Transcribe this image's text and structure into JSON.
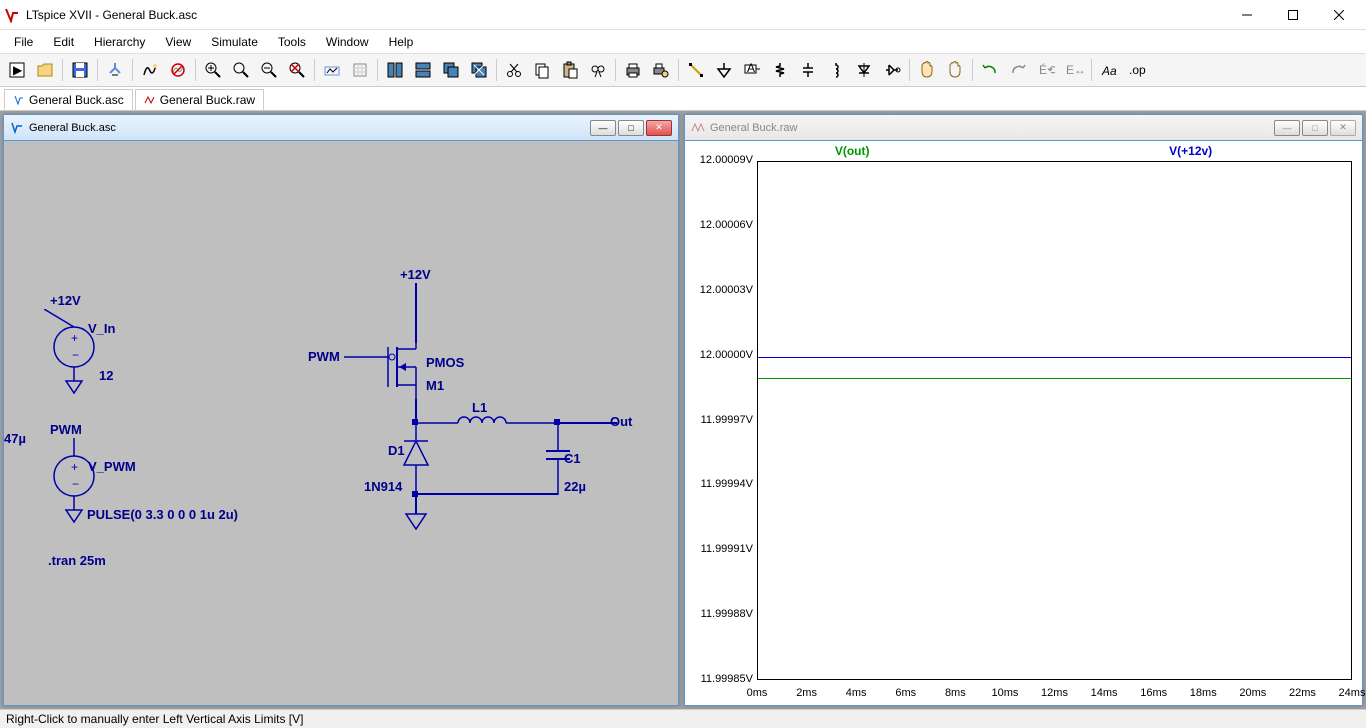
{
  "app": {
    "title": "LTspice XVII - General Buck.asc"
  },
  "menu": {
    "file": "File",
    "edit": "Edit",
    "hierarchy": "Hierarchy",
    "view": "View",
    "simulate": "Simulate",
    "tools": "Tools",
    "window": "Window",
    "help": "Help"
  },
  "tabs": {
    "schematic": "General Buck.asc",
    "raw": "General Buck.raw"
  },
  "subwin": {
    "schematic_title": "General Buck.asc",
    "plot_title": "General Buck.raw"
  },
  "schematic": {
    "net_12v": "+12V",
    "v_in": "V_In",
    "v_in_val": "12",
    "net_pwm": "PWM",
    "v_pwm": "V_PWM",
    "v_pwm_val": "PULSE(0 3.3 0 0 0 1u 2u)",
    "tran": ".tran 25m",
    "net_12v_2": "+12V",
    "pwm_label": "PWM",
    "pmos": "PMOS",
    "m1": "M1",
    "l1": "L1",
    "l1_val": "47µ",
    "d1": "D1",
    "d1_val": "1N914",
    "c1": "C1",
    "c1_val": "22µ",
    "out": "Out"
  },
  "plot": {
    "legend_vout": "V(out)",
    "legend_v12": "V(+12v)"
  },
  "chart_data": {
    "type": "line",
    "title": "",
    "xlabel": "",
    "ylabel": "",
    "x_unit": "ms",
    "y_unit": "V",
    "xlim": [
      0,
      24
    ],
    "ylim": [
      11.99985,
      12.00009
    ],
    "xticks": [
      0,
      2,
      4,
      6,
      8,
      10,
      12,
      14,
      16,
      18,
      20,
      22,
      24
    ],
    "xtick_labels": [
      "0ms",
      "2ms",
      "4ms",
      "6ms",
      "8ms",
      "10ms",
      "12ms",
      "14ms",
      "16ms",
      "18ms",
      "20ms",
      "22ms",
      "24ms"
    ],
    "yticks": [
      11.99985,
      11.99988,
      11.99991,
      11.99994,
      11.99997,
      12.0,
      12.00003,
      12.00006,
      12.00009
    ],
    "ytick_labels": [
      "11.99985V",
      "11.99988V",
      "11.99991V",
      "11.99994V",
      "11.99997V",
      "12.00000V",
      "12.00003V",
      "12.00006V",
      "12.00009V"
    ],
    "series": [
      {
        "name": "V(out)",
        "color": "#009600",
        "constant_value": 11.99999
      },
      {
        "name": "V(+12v)",
        "color": "#0000c8",
        "constant_value": 12.0
      }
    ]
  },
  "status": {
    "text": "Right-Click to manually enter Left Vertical Axis Limits [V]"
  }
}
